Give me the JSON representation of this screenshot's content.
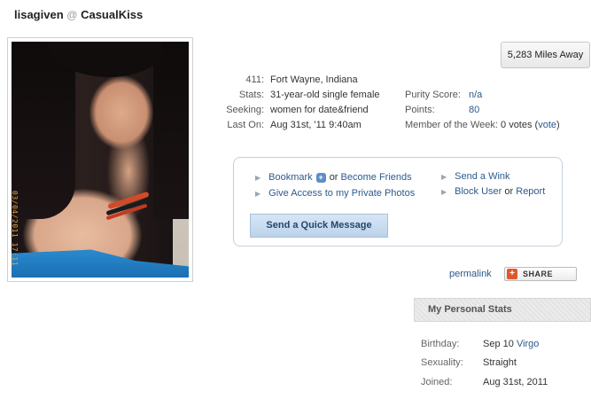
{
  "header": {
    "username": "lisagiven",
    "at": "@",
    "site": "CasualKiss"
  },
  "photo": {
    "stamp": "03/04/2011 17:11"
  },
  "distance_button": "5,283 Miles Away",
  "profile": {
    "labels": [
      "411:",
      "Stats:",
      "Seeking:",
      "Last On:"
    ],
    "values": [
      "Fort Wayne, Indiana",
      "31-year-old single female",
      "women for date&friend",
      "Aug 31st, '11 9:40am"
    ]
  },
  "scores": {
    "purity_label": "Purity Score:",
    "purity_value": "n/a",
    "points_label": "Points:",
    "points_value": "80",
    "motw_label": "Member of the Week:",
    "motw_votes": "0 votes (",
    "motw_vote_link": "vote",
    "motw_close": ")"
  },
  "actions": {
    "bookmark": "Bookmark",
    "or_text": "or",
    "become_friends": "Become Friends",
    "give_access": "Give Access to my Private Photos",
    "send_wink": "Send a Wink",
    "block_user": "Block User",
    "or_text2": "or",
    "report": "Report",
    "quick_message": "Send a Quick Message"
  },
  "permalink": "permalink",
  "share": "SHARE",
  "personal_stats": {
    "title": "My Personal Stats",
    "birthday_label": "Birthday:",
    "birthday_value": "Sep 10",
    "birthday_sign": "Virgo",
    "sexuality_label": "Sexuality:",
    "sexuality_value": "Straight",
    "joined_label": "Joined:",
    "joined_value": "Aug 31st, 2011"
  },
  "colors": {
    "link": "#2c5a8c",
    "button_blue": "#bcd2ea",
    "share_orange": "#e2562b"
  }
}
